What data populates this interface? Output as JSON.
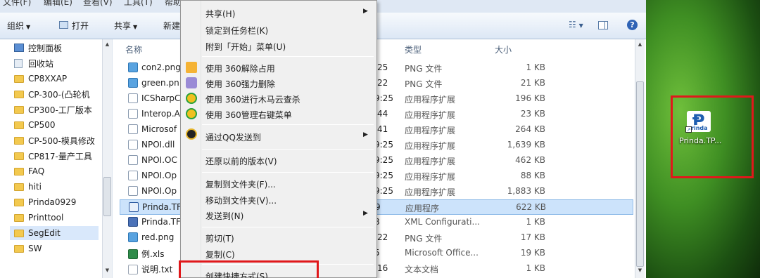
{
  "menubar": {
    "items": [
      "文件(F)",
      "编辑(E)",
      "查看(V)",
      "工具(T)",
      "帮助"
    ]
  },
  "toolbar": {
    "organize": "组织",
    "open": "打开",
    "share": "共享",
    "new": "新建"
  },
  "nav": {
    "items": [
      {
        "label": "控制面板",
        "kind": "system"
      },
      {
        "label": "回收站",
        "kind": "bin"
      },
      {
        "label": "CP8XXAP",
        "kind": "folder"
      },
      {
        "label": "CP-300-(凸轮机",
        "kind": "folder"
      },
      {
        "label": "CP300-工厂版本",
        "kind": "folder"
      },
      {
        "label": "CP500",
        "kind": "folder"
      },
      {
        "label": "CP-500-模具修改",
        "kind": "folder"
      },
      {
        "label": "CP817-量产工具",
        "kind": "folder"
      },
      {
        "label": "FAQ",
        "kind": "folder"
      },
      {
        "label": "hiti",
        "kind": "folder"
      },
      {
        "label": "Prinda0929",
        "kind": "folder"
      },
      {
        "label": "Printtool",
        "kind": "folder"
      },
      {
        "label": "SegEdit",
        "kind": "folder",
        "selected": true
      },
      {
        "label": "SW",
        "kind": "folder"
      }
    ]
  },
  "columns": {
    "name": "名称",
    "type": "类型",
    "size": "大小"
  },
  "files": [
    {
      "name": "con2.png",
      "date": ":25",
      "type": "PNG 文件",
      "size": "1 KB",
      "icon": "png"
    },
    {
      "name": "green.pn",
      "date": ":22",
      "type": "PNG 文件",
      "size": "21 KB",
      "icon": "png"
    },
    {
      "name": "ICSharpC",
      "date": "9:25",
      "type": "应用程序扩展",
      "size": "196 KB",
      "icon": "dll"
    },
    {
      "name": "Interop.A",
      "date": ":44",
      "type": "应用程序扩展",
      "size": "23 KB",
      "icon": "dll"
    },
    {
      "name": "Microsof",
      "date": ":41",
      "type": "应用程序扩展",
      "size": "264 KB",
      "icon": "dll"
    },
    {
      "name": "NPOI.dll",
      "date": "9:25",
      "type": "应用程序扩展",
      "size": "1,639 KB",
      "icon": "dll"
    },
    {
      "name": "NPOI.OC",
      "date": "9:25",
      "type": "应用程序扩展",
      "size": "462 KB",
      "icon": "dll"
    },
    {
      "name": "NPOI.Op",
      "date": "9:25",
      "type": "应用程序扩展",
      "size": "88 KB",
      "icon": "dll"
    },
    {
      "name": "NPOI.Op",
      "date": "9:25",
      "type": "应用程序扩展",
      "size": "1,883 KB",
      "icon": "dll"
    },
    {
      "name": "Prinda.TF",
      "date": "9",
      "type": "应用程序",
      "size": "622 KB",
      "icon": "exe",
      "selected": true
    },
    {
      "name": "Prinda.TF",
      "date": "8",
      "type": "XML Configurati...",
      "size": "1 KB",
      "icon": "cfg"
    },
    {
      "name": "red.png",
      "date": ":22",
      "type": "PNG 文件",
      "size": "17 KB",
      "icon": "png"
    },
    {
      "name": "例.xls",
      "date": "5",
      "type": "Microsoft Office...",
      "size": "19 KB",
      "icon": "xls"
    },
    {
      "name": "说明.txt",
      "date": ":16",
      "type": "文本文档",
      "size": "1 KB",
      "icon": "txt"
    }
  ],
  "context_menu": {
    "items": [
      {
        "label": "共享(H)",
        "submenu": true
      },
      {
        "label": "锁定到任务栏(K)"
      },
      {
        "label": "附到「开始」菜单(U)"
      },
      {
        "sep": true
      },
      {
        "label": "使用 360解除占用",
        "icon": "ico-360a"
      },
      {
        "label": "使用 360强力删除",
        "icon": "ico-360b"
      },
      {
        "label": "使用 360进行木马云查杀",
        "icon": "ico-360g"
      },
      {
        "label": "使用 360管理右键菜单",
        "icon": "ico-360g"
      },
      {
        "sep": true
      },
      {
        "label": "通过QQ发送到",
        "icon": "ico-qq",
        "submenu": true
      },
      {
        "sep": true
      },
      {
        "label": "还原以前的版本(V)"
      },
      {
        "sep": true
      },
      {
        "label": "复制到文件夹(F)..."
      },
      {
        "label": "移动到文件夹(V)..."
      },
      {
        "label": "发送到(N)",
        "submenu": true
      },
      {
        "sep": true
      },
      {
        "label": "剪切(T)"
      },
      {
        "label": "复制(C)"
      },
      {
        "sep": true
      },
      {
        "label": "创建快捷方式(S)",
        "highlighted": true
      }
    ]
  },
  "desktop": {
    "shortcut_label": "Prinda.TP...",
    "logo_text": "rinda"
  },
  "colors": {
    "highlight_box": "#e0181b",
    "selection": "#cce3fb"
  }
}
